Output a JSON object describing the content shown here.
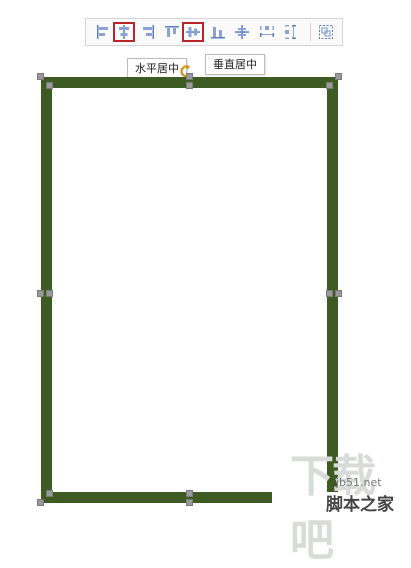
{
  "toolbar": {
    "buttons": [
      {
        "name": "align-left-button",
        "icon": "align-left-icon",
        "highlighted": false
      },
      {
        "name": "align-horizontal-center-button",
        "icon": "align-horizontal-center-icon",
        "highlighted": true
      },
      {
        "name": "align-right-button",
        "icon": "align-right-icon",
        "highlighted": false
      },
      {
        "name": "align-top-button",
        "icon": "align-top-icon",
        "highlighted": false
      },
      {
        "name": "align-vertical-center-button",
        "icon": "align-vertical-center-icon",
        "highlighted": true
      },
      {
        "name": "align-bottom-button",
        "icon": "align-bottom-icon",
        "highlighted": false
      },
      {
        "name": "center-on-page-button",
        "icon": "center-on-page-icon",
        "highlighted": false
      },
      {
        "name": "distribute-horizontal-button",
        "icon": "distribute-horizontal-icon",
        "highlighted": false
      },
      {
        "name": "distribute-vertical-button",
        "icon": "distribute-vertical-icon",
        "highlighted": false
      },
      {
        "name": "group-button",
        "icon": "group-icon",
        "highlighted": false
      }
    ]
  },
  "tooltips": {
    "horizontal_center": "水平居中",
    "vertical_center": "垂直居中"
  },
  "watermark": {
    "logo_text": "下载吧",
    "url": "jb51.net",
    "site": "脚本之家"
  },
  "colors": {
    "frame": "#3e5b24",
    "highlight": "#b8262c",
    "icon": "#5b7fc0"
  }
}
